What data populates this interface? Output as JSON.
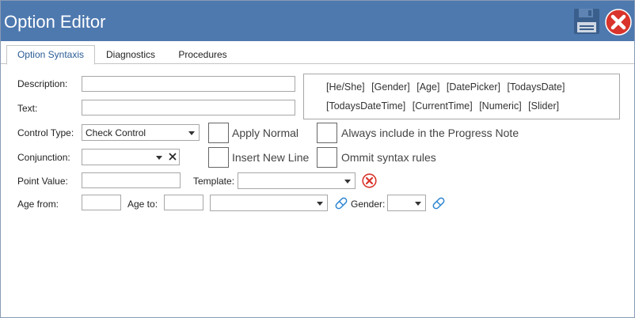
{
  "window": {
    "title": "Option Editor"
  },
  "tabs": [
    {
      "label": "Option Syntaxis"
    },
    {
      "label": "Diagnostics"
    },
    {
      "label": "Procedures"
    }
  ],
  "syntax_box": {
    "line1": [
      "[He/She]",
      "[Gender]",
      "[Age]",
      "[DatePicker]",
      "[TodaysDate]"
    ],
    "line2": [
      "[TodaysDateTime]",
      "[CurrentTime]",
      "[Numeric]",
      "[Slider]"
    ]
  },
  "form": {
    "description_label": "Description:",
    "description_value": "",
    "text_label": "Text:",
    "text_value": "",
    "control_type_label": "Control Type:",
    "control_type_value": "Check Control",
    "conjunction_label": "Conjunction:",
    "conjunction_value": "",
    "point_value_label": "Point Value:",
    "point_value_value": "",
    "template_label": "Template:",
    "template_value": "",
    "age_from_label": "Age from:",
    "age_from_value": "",
    "age_to_label": "Age to:",
    "age_to_value": "",
    "age_unit_value": "",
    "gender_label": "Gender:",
    "gender_value": ""
  },
  "checkboxes": {
    "apply_normal": "Apply Normal",
    "always_include": "Always include in the Progress Note",
    "insert_new_line": "Insert New Line",
    "ommit_syntax": "Ommit syntax rules"
  },
  "colors": {
    "titlebar": "#4e79af",
    "accent_tab": "#2a5c96",
    "close_red": "#d9342b",
    "link_icon": "#2e86d1"
  }
}
